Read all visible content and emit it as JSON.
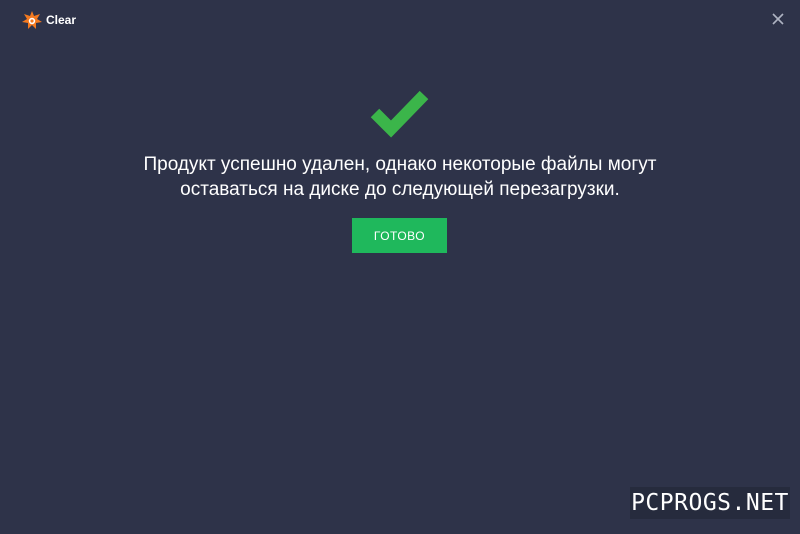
{
  "window": {
    "title": "Clear",
    "logo_icon": "avast-logo-icon",
    "close_icon": "close-icon"
  },
  "status": {
    "icon": "checkmark-icon",
    "icon_color": "#3bb54a",
    "message_line1": "Продукт успешно удален, однако некоторые файлы могут",
    "message_line2": "оставаться на диске до следующей перезагрузки."
  },
  "actions": {
    "done_label": "ГОТОВО",
    "done_color": "#1fb85c"
  },
  "watermark": {
    "text": "PCPROGS.NET"
  },
  "colors": {
    "background": "#2e3349",
    "logo_orange": "#f47a20"
  }
}
